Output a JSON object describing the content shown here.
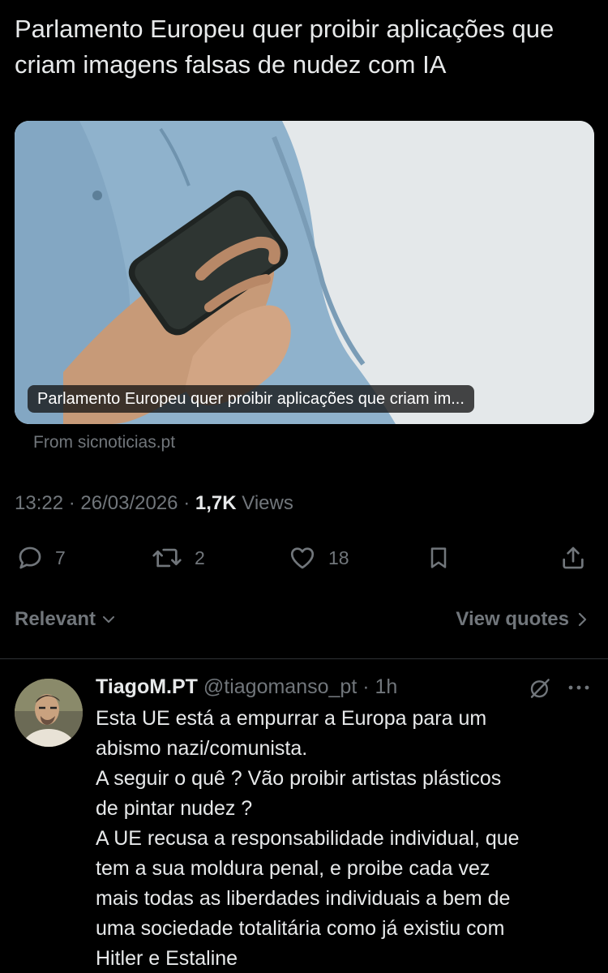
{
  "post": {
    "text_lines": [
      "Parlamento Europeu quer proibir aplicações que",
      "criam imagens falsas de nudez com IA"
    ]
  },
  "link_card": {
    "caption": "Parlamento Europeu quer proibir aplicações que criam im...",
    "source": "From sicnoticias.pt",
    "image": "hands-holding-smartphone-photo"
  },
  "meta": {
    "time": "13:22",
    "separator": "·",
    "date": "26/03/2026",
    "views_count": "1,7K",
    "views_label": "Views"
  },
  "actions": {
    "replies": "7",
    "reposts": "2",
    "likes": "18",
    "icons": [
      "reply-icon",
      "repost-icon",
      "like-icon",
      "bookmark-icon",
      "share-icon"
    ]
  },
  "filters": {
    "sort_label": "Relevant",
    "view_quotes": "View quotes"
  },
  "reply": {
    "display_name": "TiagoM.PT",
    "handle": "@tiagomanso_pt",
    "separator": "·",
    "time": "1h",
    "text_lines": [
      "Esta UE está a empurrar a Europa para um",
      "abismo nazi/comunista.",
      "A seguir o quê ? Vão proibir artistas plásticos",
      "de pintar nudez ?",
      "A UE recusa a responsabilidade individual, que",
      "tem a sua moldura penal, e proibe cada vez",
      "mais todas as liberdades individuais a bem de",
      "uma sociedade totalitária como já existiu com",
      "Hitler e Estaline"
    ]
  },
  "colors": {
    "background": "#000000",
    "text": "#e7e9ea",
    "secondary": "#71767b",
    "divider": "#2f3336"
  }
}
